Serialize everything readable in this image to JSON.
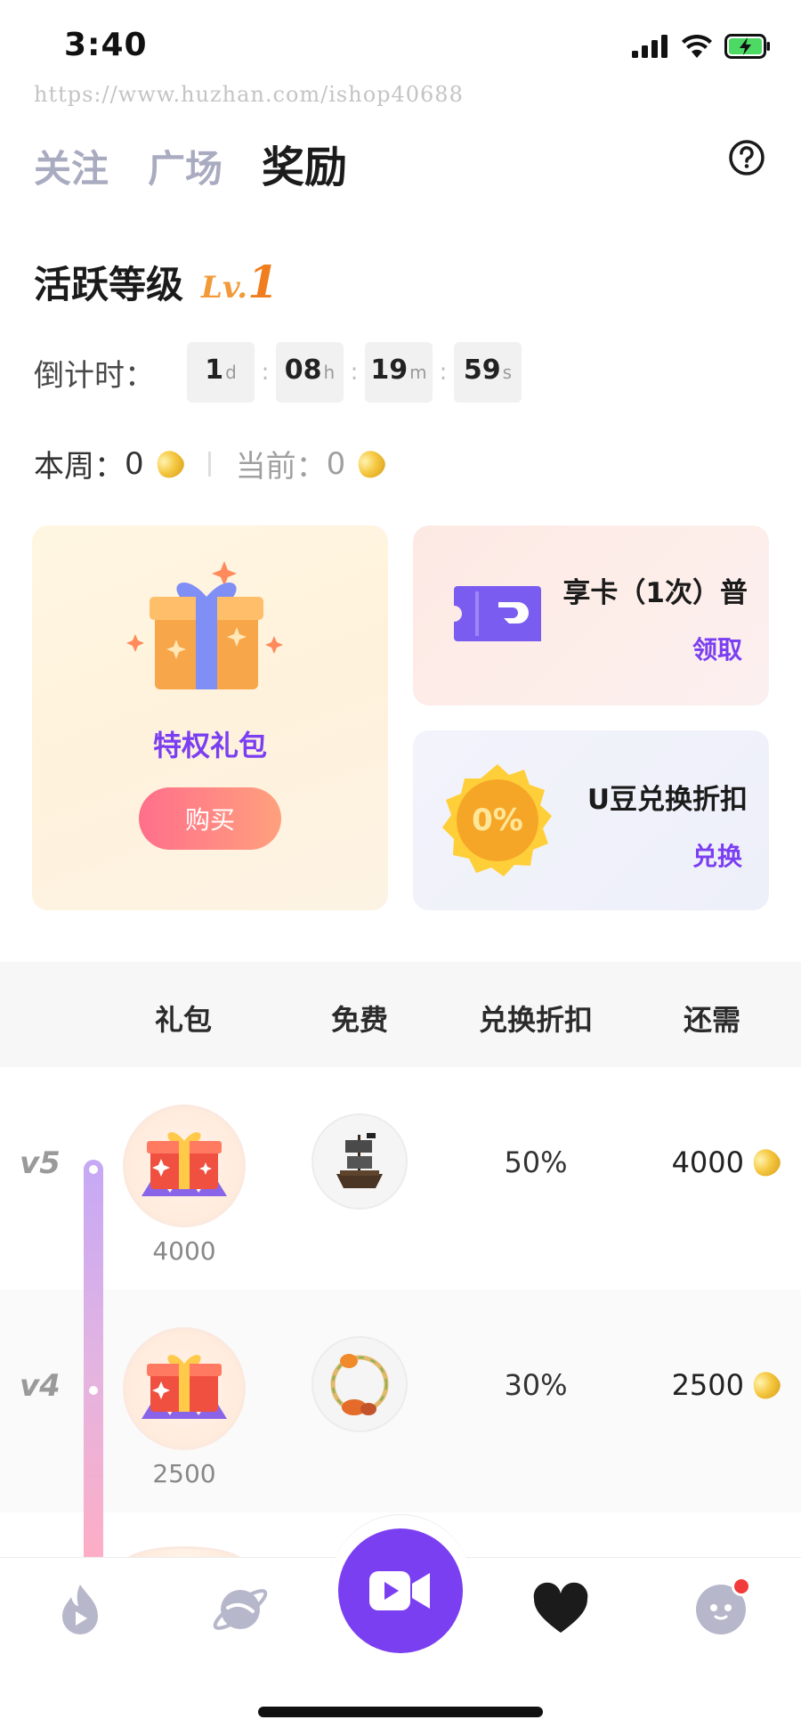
{
  "status_bar": {
    "time": "3:40"
  },
  "watermark": "https://www.huzhan.com/ishop40688",
  "tabs": [
    {
      "label": "关注"
    },
    {
      "label": "广场"
    },
    {
      "label": "奖励"
    }
  ],
  "level": {
    "title": "活跃等级",
    "badge_prefix": "Lv.",
    "badge_level": "1"
  },
  "countdown": {
    "label": "倒计时：",
    "days": "1",
    "days_unit": "d",
    "hours": "08",
    "hours_unit": "h",
    "minutes": "19",
    "minutes_unit": "m",
    "seconds": "59",
    "seconds_unit": "s",
    "separator": ":"
  },
  "beans": {
    "week_label": "本周：",
    "week_value": "0",
    "current_label": "当前：",
    "current_value": "0"
  },
  "gift_card": {
    "name": "特权礼包",
    "button": "购买"
  },
  "ticket_card": {
    "text": "享卡（1次）普",
    "action": "领取"
  },
  "coupon_card": {
    "badge": "0%",
    "text": "U豆兑换折扣",
    "action": "兑换"
  },
  "table": {
    "headers": [
      "礼包",
      "免费",
      "兑换折扣",
      "还需"
    ],
    "rows": [
      {
        "level": "v5",
        "gift_price": "4000",
        "free_item": "pirate-ship-icon",
        "discount": "50%",
        "need": "4000"
      },
      {
        "level": "v4",
        "gift_price": "2500",
        "free_item": "pumpkin-frame-icon",
        "discount": "30%",
        "need": "2500"
      }
    ]
  },
  "colors": {
    "accent": "#7b3ff2",
    "buy_gradient_start": "#ff6f8b",
    "buy_gradient_end": "#ffa07d",
    "level_badge": "#f07e1f"
  },
  "nav": [
    "flame-icon",
    "planet-icon",
    "video-camera-icon",
    "heart-icon",
    "avatar-icon"
  ]
}
